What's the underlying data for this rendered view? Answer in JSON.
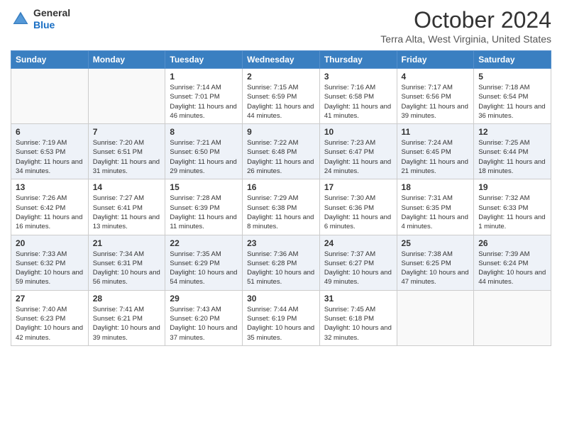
{
  "header": {
    "logo": {
      "general": "General",
      "blue": "Blue"
    },
    "title": "October 2024",
    "location": "Terra Alta, West Virginia, United States"
  },
  "days_of_week": [
    "Sunday",
    "Monday",
    "Tuesday",
    "Wednesday",
    "Thursday",
    "Friday",
    "Saturday"
  ],
  "weeks": [
    [
      {
        "day": "",
        "sunrise": "",
        "sunset": "",
        "daylight": ""
      },
      {
        "day": "",
        "sunrise": "",
        "sunset": "",
        "daylight": ""
      },
      {
        "day": "1",
        "sunrise": "Sunrise: 7:14 AM",
        "sunset": "Sunset: 7:01 PM",
        "daylight": "Daylight: 11 hours and 46 minutes."
      },
      {
        "day": "2",
        "sunrise": "Sunrise: 7:15 AM",
        "sunset": "Sunset: 6:59 PM",
        "daylight": "Daylight: 11 hours and 44 minutes."
      },
      {
        "day": "3",
        "sunrise": "Sunrise: 7:16 AM",
        "sunset": "Sunset: 6:58 PM",
        "daylight": "Daylight: 11 hours and 41 minutes."
      },
      {
        "day": "4",
        "sunrise": "Sunrise: 7:17 AM",
        "sunset": "Sunset: 6:56 PM",
        "daylight": "Daylight: 11 hours and 39 minutes."
      },
      {
        "day": "5",
        "sunrise": "Sunrise: 7:18 AM",
        "sunset": "Sunset: 6:54 PM",
        "daylight": "Daylight: 11 hours and 36 minutes."
      }
    ],
    [
      {
        "day": "6",
        "sunrise": "Sunrise: 7:19 AM",
        "sunset": "Sunset: 6:53 PM",
        "daylight": "Daylight: 11 hours and 34 minutes."
      },
      {
        "day": "7",
        "sunrise": "Sunrise: 7:20 AM",
        "sunset": "Sunset: 6:51 PM",
        "daylight": "Daylight: 11 hours and 31 minutes."
      },
      {
        "day": "8",
        "sunrise": "Sunrise: 7:21 AM",
        "sunset": "Sunset: 6:50 PM",
        "daylight": "Daylight: 11 hours and 29 minutes."
      },
      {
        "day": "9",
        "sunrise": "Sunrise: 7:22 AM",
        "sunset": "Sunset: 6:48 PM",
        "daylight": "Daylight: 11 hours and 26 minutes."
      },
      {
        "day": "10",
        "sunrise": "Sunrise: 7:23 AM",
        "sunset": "Sunset: 6:47 PM",
        "daylight": "Daylight: 11 hours and 24 minutes."
      },
      {
        "day": "11",
        "sunrise": "Sunrise: 7:24 AM",
        "sunset": "Sunset: 6:45 PM",
        "daylight": "Daylight: 11 hours and 21 minutes."
      },
      {
        "day": "12",
        "sunrise": "Sunrise: 7:25 AM",
        "sunset": "Sunset: 6:44 PM",
        "daylight": "Daylight: 11 hours and 18 minutes."
      }
    ],
    [
      {
        "day": "13",
        "sunrise": "Sunrise: 7:26 AM",
        "sunset": "Sunset: 6:42 PM",
        "daylight": "Daylight: 11 hours and 16 minutes."
      },
      {
        "day": "14",
        "sunrise": "Sunrise: 7:27 AM",
        "sunset": "Sunset: 6:41 PM",
        "daylight": "Daylight: 11 hours and 13 minutes."
      },
      {
        "day": "15",
        "sunrise": "Sunrise: 7:28 AM",
        "sunset": "Sunset: 6:39 PM",
        "daylight": "Daylight: 11 hours and 11 minutes."
      },
      {
        "day": "16",
        "sunrise": "Sunrise: 7:29 AM",
        "sunset": "Sunset: 6:38 PM",
        "daylight": "Daylight: 11 hours and 8 minutes."
      },
      {
        "day": "17",
        "sunrise": "Sunrise: 7:30 AM",
        "sunset": "Sunset: 6:36 PM",
        "daylight": "Daylight: 11 hours and 6 minutes."
      },
      {
        "day": "18",
        "sunrise": "Sunrise: 7:31 AM",
        "sunset": "Sunset: 6:35 PM",
        "daylight": "Daylight: 11 hours and 4 minutes."
      },
      {
        "day": "19",
        "sunrise": "Sunrise: 7:32 AM",
        "sunset": "Sunset: 6:33 PM",
        "daylight": "Daylight: 11 hours and 1 minute."
      }
    ],
    [
      {
        "day": "20",
        "sunrise": "Sunrise: 7:33 AM",
        "sunset": "Sunset: 6:32 PM",
        "daylight": "Daylight: 10 hours and 59 minutes."
      },
      {
        "day": "21",
        "sunrise": "Sunrise: 7:34 AM",
        "sunset": "Sunset: 6:31 PM",
        "daylight": "Daylight: 10 hours and 56 minutes."
      },
      {
        "day": "22",
        "sunrise": "Sunrise: 7:35 AM",
        "sunset": "Sunset: 6:29 PM",
        "daylight": "Daylight: 10 hours and 54 minutes."
      },
      {
        "day": "23",
        "sunrise": "Sunrise: 7:36 AM",
        "sunset": "Sunset: 6:28 PM",
        "daylight": "Daylight: 10 hours and 51 minutes."
      },
      {
        "day": "24",
        "sunrise": "Sunrise: 7:37 AM",
        "sunset": "Sunset: 6:27 PM",
        "daylight": "Daylight: 10 hours and 49 minutes."
      },
      {
        "day": "25",
        "sunrise": "Sunrise: 7:38 AM",
        "sunset": "Sunset: 6:25 PM",
        "daylight": "Daylight: 10 hours and 47 minutes."
      },
      {
        "day": "26",
        "sunrise": "Sunrise: 7:39 AM",
        "sunset": "Sunset: 6:24 PM",
        "daylight": "Daylight: 10 hours and 44 minutes."
      }
    ],
    [
      {
        "day": "27",
        "sunrise": "Sunrise: 7:40 AM",
        "sunset": "Sunset: 6:23 PM",
        "daylight": "Daylight: 10 hours and 42 minutes."
      },
      {
        "day": "28",
        "sunrise": "Sunrise: 7:41 AM",
        "sunset": "Sunset: 6:21 PM",
        "daylight": "Daylight: 10 hours and 39 minutes."
      },
      {
        "day": "29",
        "sunrise": "Sunrise: 7:43 AM",
        "sunset": "Sunset: 6:20 PM",
        "daylight": "Daylight: 10 hours and 37 minutes."
      },
      {
        "day": "30",
        "sunrise": "Sunrise: 7:44 AM",
        "sunset": "Sunset: 6:19 PM",
        "daylight": "Daylight: 10 hours and 35 minutes."
      },
      {
        "day": "31",
        "sunrise": "Sunrise: 7:45 AM",
        "sunset": "Sunset: 6:18 PM",
        "daylight": "Daylight: 10 hours and 32 minutes."
      },
      {
        "day": "",
        "sunrise": "",
        "sunset": "",
        "daylight": ""
      },
      {
        "day": "",
        "sunrise": "",
        "sunset": "",
        "daylight": ""
      }
    ]
  ]
}
